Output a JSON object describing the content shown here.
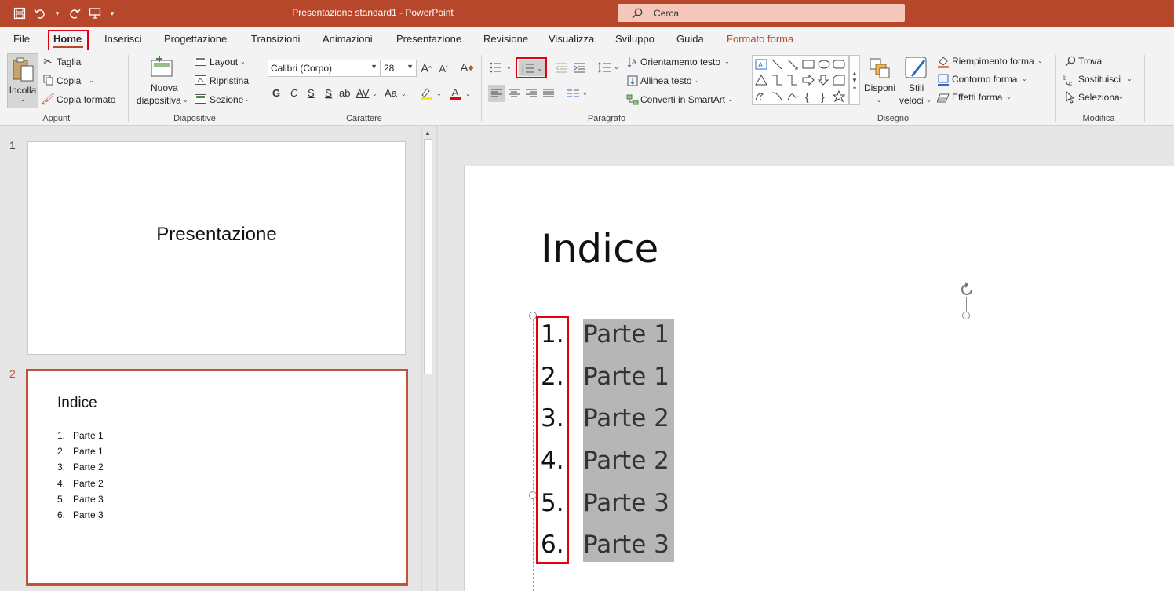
{
  "titlebar": {
    "title": "Presentazione standard1  -  PowerPoint",
    "search_placeholder": "Cerca",
    "qat": [
      "save-icon",
      "undo-icon",
      "redo-icon",
      "presentation-icon",
      "customize-icon"
    ]
  },
  "tabs": [
    "File",
    "Home",
    "Inserisci",
    "Progettazione",
    "Transizioni",
    "Animazioni",
    "Presentazione",
    "Revisione",
    "Visualizza",
    "Sviluppo",
    "Guida",
    "Formato forma"
  ],
  "ribbon": {
    "appunti": {
      "label": "Appunti",
      "paste": "Incolla",
      "cut": "Taglia",
      "copy": "Copia",
      "format_painter": "Copia formato"
    },
    "diapositive": {
      "label": "Diapositive",
      "new_slide_1": "Nuova",
      "new_slide_2": "diapositiva",
      "layout": "Layout",
      "reset": "Ripristina",
      "section": "Sezione"
    },
    "carattere": {
      "label": "Carattere",
      "font": "Calibri (Corpo)",
      "size": "28",
      "bold": "G",
      "italic": "C",
      "underline": "S",
      "shadow": "S",
      "strike": "ab",
      "spacing": "AV",
      "case": "Aa"
    },
    "paragrafo": {
      "label": "Paragrafo",
      "text_direction": "Orientamento testo",
      "align_text": "Allinea testo",
      "smartart": "Converti in SmartArt"
    },
    "disegno": {
      "label": "Disegno",
      "arrange": "Disponi",
      "styles_1": "Stili",
      "styles_2": "veloci",
      "fill": "Riempimento forma",
      "outline": "Contorno forma",
      "effects": "Effetti forma"
    },
    "modifica": {
      "label": "Modifica",
      "find": "Trova",
      "replace": "Sostituisci",
      "select": "Seleziona"
    }
  },
  "thumbnails": {
    "slide1": {
      "number": "1",
      "title": "Presentazione"
    },
    "slide2": {
      "number": "2",
      "title": "Indice",
      "items": [
        {
          "n": "1.",
          "text": "Parte 1"
        },
        {
          "n": "2.",
          "text": "Parte 1"
        },
        {
          "n": "3.",
          "text": "Parte 2"
        },
        {
          "n": "4.",
          "text": "Parte 2"
        },
        {
          "n": "5.",
          "text": "Parte 3"
        },
        {
          "n": "6.",
          "text": "Parte 3"
        }
      ]
    }
  },
  "slide": {
    "title": "Indice",
    "numbers": [
      "1.",
      "2.",
      "3.",
      "4.",
      "5.",
      "6."
    ],
    "items": [
      "Parte 1",
      "Parte 1",
      "Parte 2",
      "Parte 2",
      "Parte 3",
      "Parte 3"
    ]
  },
  "colors": {
    "accent": "#b7472a",
    "highlight_box": "#e3000f",
    "selection_fill": "#b6b6b6"
  }
}
